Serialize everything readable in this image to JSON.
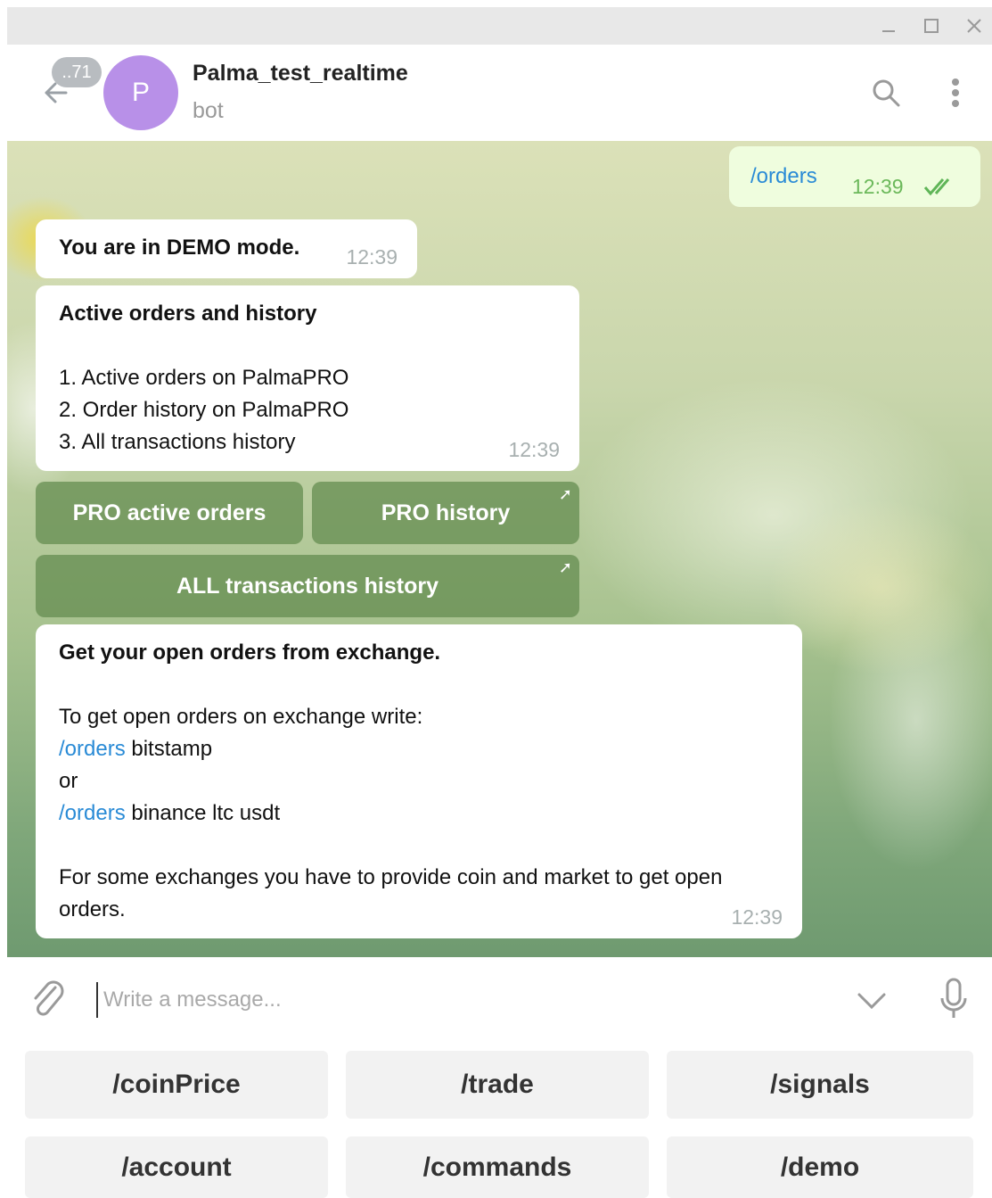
{
  "window": {
    "minimize_icon": "minimize-icon",
    "maximize_icon": "maximize-icon",
    "close_icon": "close-icon"
  },
  "header": {
    "unread_count": "..71",
    "avatar_letter": "P",
    "title": "Palma_test_realtime",
    "subtitle": "bot"
  },
  "colors": {
    "avatar": "#b890e8",
    "link": "#2a8bd6",
    "inline_button": "#648c50",
    "outgoing_bubble": "#effdde"
  },
  "messages": {
    "outgoing": {
      "text": "/orders",
      "time": "12:39"
    },
    "demo": {
      "text": "You are in DEMO mode.",
      "time": "12:39"
    },
    "active": {
      "title": "Active orders and history",
      "line1": "1. Active orders on PalmaPRO",
      "line2": "2. Order history on PalmaPRO",
      "line3": "3. All transactions history",
      "time": "12:39"
    },
    "open_orders": {
      "title": "Get your open orders from exchange.",
      "intro": "To get open orders on exchange write:",
      "cmd1": "/orders",
      "arg1": " bitstamp",
      "or": "or",
      "cmd2": "/orders",
      "arg2": " binance ltc usdt",
      "note": "For some exchanges you have to provide coin and market to get open orders.",
      "time": "12:39"
    }
  },
  "inline_buttons": {
    "pro_active": "PRO active orders",
    "pro_history": "PRO history",
    "all_history": "ALL transactions history"
  },
  "input": {
    "placeholder": "Write a message..."
  },
  "keyboard": {
    "row1": [
      "/coinPrice",
      "/trade",
      "/signals"
    ],
    "row2": [
      "/account",
      "/commands",
      "/demo"
    ]
  }
}
